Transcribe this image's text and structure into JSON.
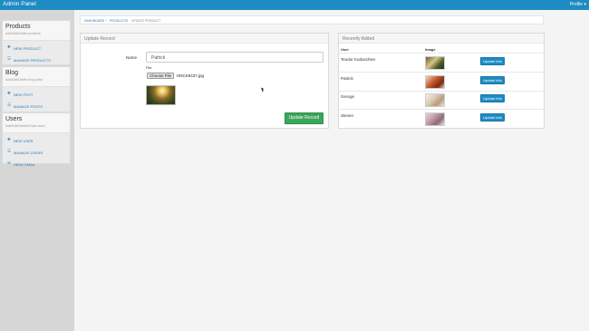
{
  "app": {
    "title": "Admin Panel",
    "profile_label": "Profile"
  },
  "sidebar": {
    "sections": [
      {
        "title": "Products",
        "subtitle": "Add/Edit/Delete products",
        "items": [
          {
            "label": "NEW PRODUCT",
            "icon": "plus-icon"
          },
          {
            "label": "MANAGE PRODUCTS",
            "icon": "list-icon"
          }
        ]
      },
      {
        "title": "Blog",
        "subtitle": "Add/Edit/Delete blog posts",
        "items": [
          {
            "label": "NEW POST",
            "icon": "plus-icon"
          },
          {
            "label": "MANAGE POSTS",
            "icon": "list-icon"
          }
        ]
      },
      {
        "title": "Users",
        "subtitle": "Add/Edit/Delete/Email users",
        "items": [
          {
            "label": "NEW USER",
            "icon": "plus-icon"
          },
          {
            "label": "MANAGE USERS",
            "icon": "list-icon"
          },
          {
            "label": "SEND EMAIL",
            "icon": "envelope-icon"
          }
        ]
      }
    ]
  },
  "breadcrumb": [
    "DASHBOARD",
    "PRODUCTS",
    "UPDATE PRODUCT"
  ],
  "update_record": {
    "header": "Update Record",
    "name_label": "Name",
    "name_value": "Patrick",
    "file_label": "File",
    "choose_file_label": "Choose File",
    "file_name": "HNCK9437.jpg",
    "submit_label": "Update Record"
  },
  "recently_added": {
    "header": "Recently Added",
    "columns": [
      "User",
      "Image"
    ],
    "rows": [
      {
        "user": "Teodor Kuduschiev",
        "button": "Update Info"
      },
      {
        "user": "Patrick",
        "button": "Update Info"
      },
      {
        "user": "George",
        "button": "Update Info"
      },
      {
        "user": "Steven",
        "button": "Update Info"
      }
    ]
  },
  "colors": {
    "accent": "#1e8bc3",
    "success": "#3aa55b"
  }
}
